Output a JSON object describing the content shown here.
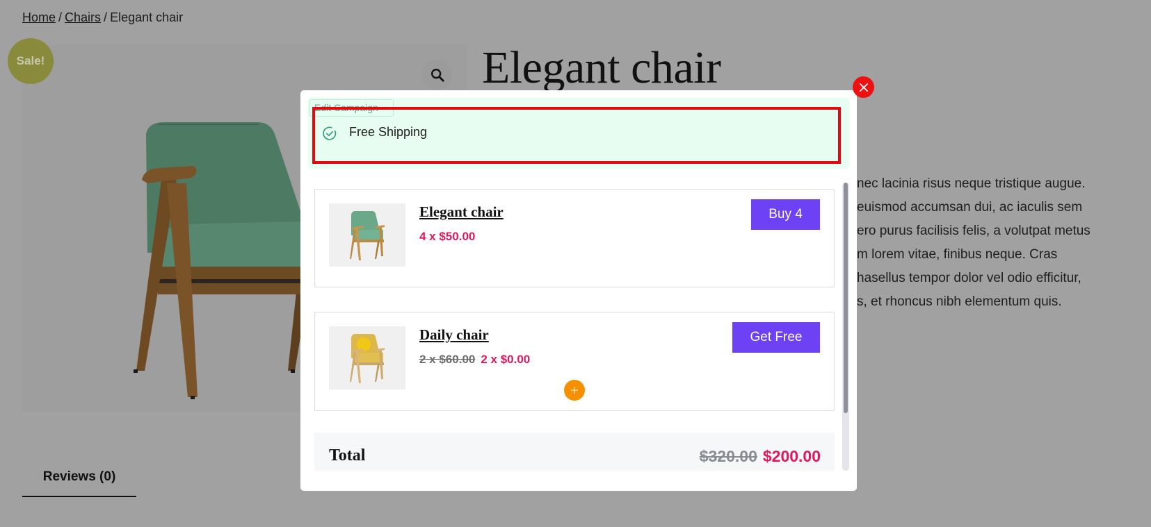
{
  "breadcrumb": {
    "items": [
      {
        "label": "Home",
        "link": true
      },
      {
        "label": "Chairs",
        "link": true
      },
      {
        "label": "Elegant chair",
        "link": false
      }
    ],
    "separator": "/"
  },
  "product": {
    "title": "Elegant chair",
    "sale_badge": "Sale!",
    "zoom_icon": "search-icon",
    "description_visible_lines": [
      "nec lacinia risus neque tristique augue.",
      "euismod accumsan dui, ac iaculis sem",
      "ero purus facilisis felis, a volutpat metus",
      "m lorem vitae, finibus neque. Cras",
      "hasellus tempor dolor vel odio efficitur,",
      "s, et rhoncus nibh elementum quis."
    ],
    "tabs": [
      {
        "label": "Reviews (0)",
        "active": true
      }
    ]
  },
  "modal": {
    "close_icon": "close-icon",
    "campaign": {
      "edit_label": "Edit Campaign",
      "message": "Free Shipping",
      "icon": "check-circle-icon"
    },
    "offers": [
      {
        "name": "Elegant chair",
        "quantity_price": "4 x $50.00",
        "old_price": "",
        "button_label": "Buy 4",
        "thumb_color": "#5e9a80"
      },
      {
        "name": "Daily chair",
        "quantity_price": "2 x $0.00",
        "old_price": "2 x $60.00",
        "button_label": "Get Free",
        "thumb_color": "#e6c14a"
      }
    ],
    "plus_icon": "plus-icon",
    "total": {
      "label": "Total",
      "old_price": "$320.00",
      "new_price": "$200.00"
    }
  },
  "colors": {
    "accent_button": "#6d41f4",
    "price_pink": "#e0185f",
    "highlight_red": "#e4090f",
    "campaign_bg": "#e8fdf2",
    "plus_orange": "#f59100",
    "overlay_gray": "#a1a1a1"
  }
}
